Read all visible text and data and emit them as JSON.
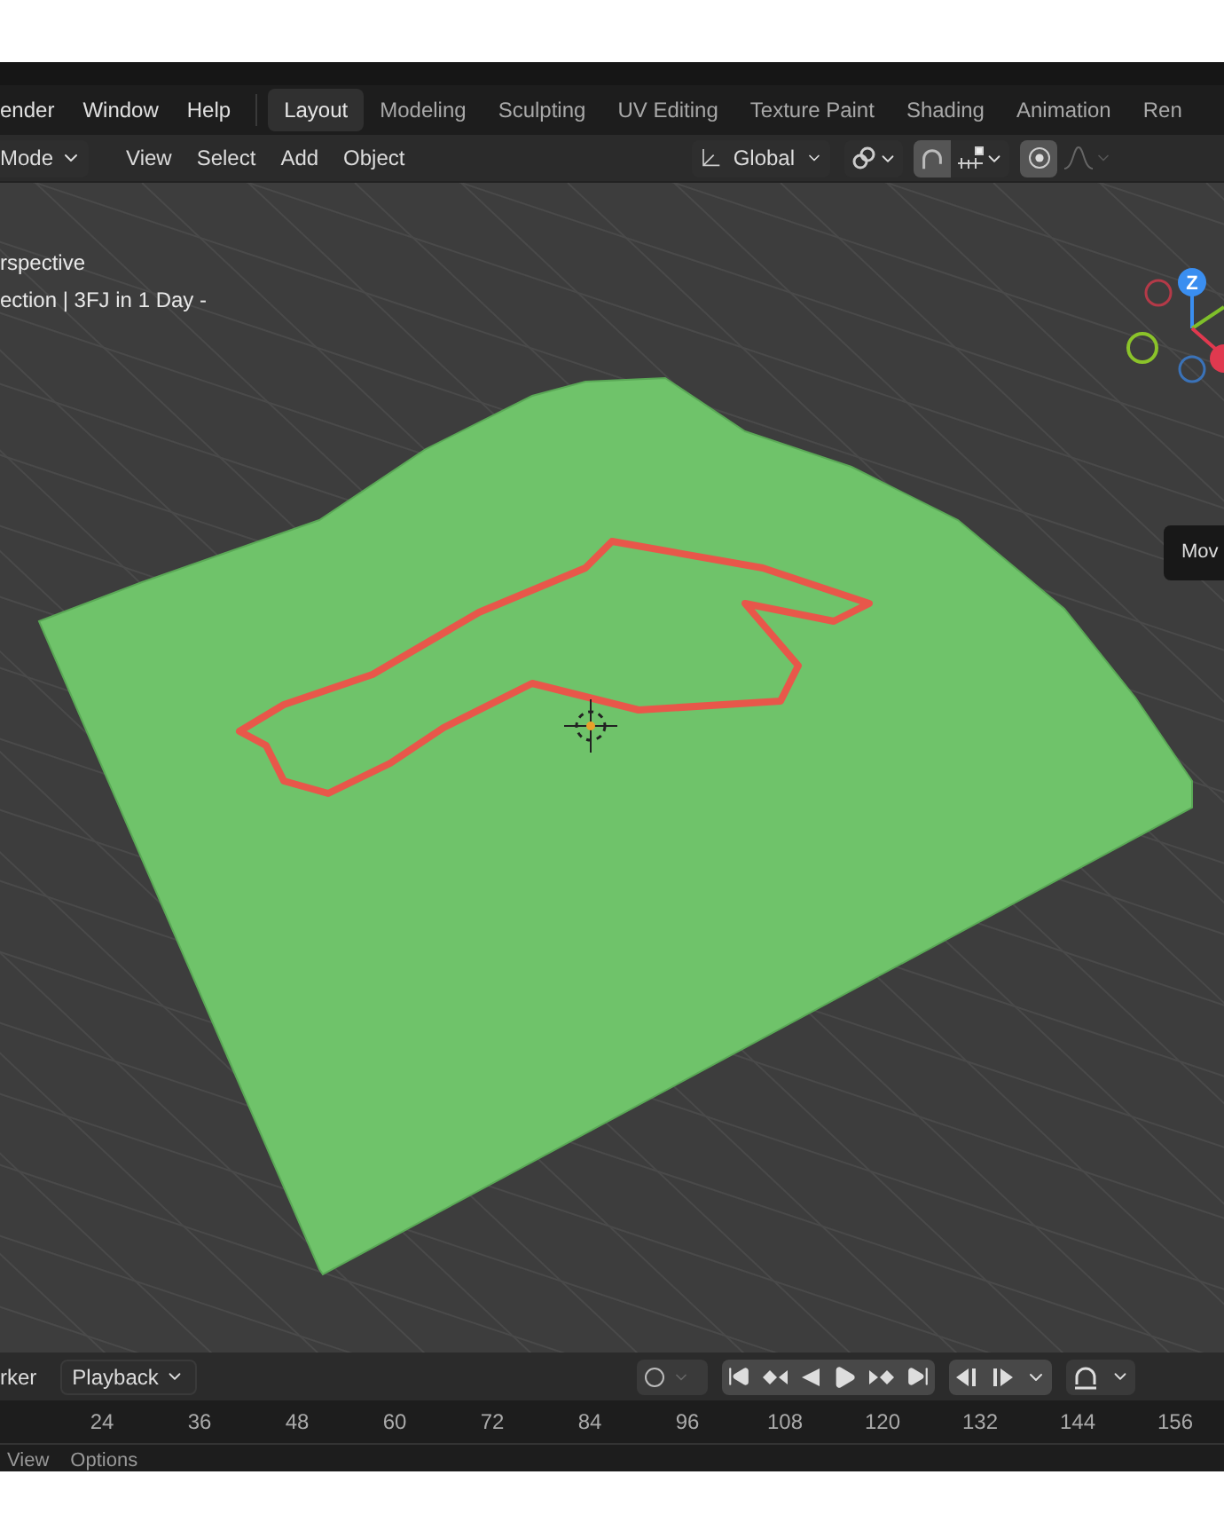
{
  "menu_bar": {
    "menus": [
      "ender",
      "Window",
      "Help"
    ],
    "workspace_tabs": [
      {
        "label": "Layout",
        "selected": true
      },
      {
        "label": "Modeling",
        "selected": false
      },
      {
        "label": "Sculpting",
        "selected": false
      },
      {
        "label": "UV Editing",
        "selected": false
      },
      {
        "label": "Texture Paint",
        "selected": false
      },
      {
        "label": "Shading",
        "selected": false
      },
      {
        "label": "Animation",
        "selected": false
      },
      {
        "label": "Ren",
        "selected": false
      }
    ]
  },
  "viewport_header": {
    "mode": "Mode",
    "menus": [
      "View",
      "Select",
      "Add",
      "Object"
    ],
    "orientation": "Global"
  },
  "viewport": {
    "overlay_lines": [
      "rspective",
      "ection | 3FJ in 1 Day -"
    ],
    "gizmo_label": "Z",
    "tooltip": "Mov"
  },
  "timeline": {
    "menus": [
      "rker"
    ],
    "playback": "Playback",
    "ruler": [
      "24",
      "36",
      "48",
      "60",
      "72",
      "84",
      "96",
      "108",
      "120",
      "132",
      "144",
      "156"
    ],
    "footer": [
      "View",
      "Options"
    ]
  }
}
